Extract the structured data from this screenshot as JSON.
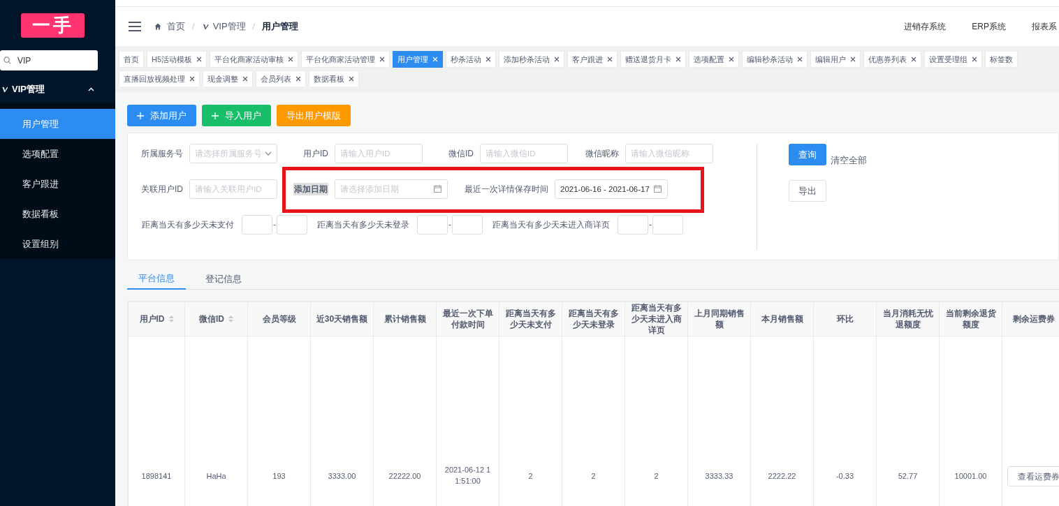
{
  "sidebar": {
    "logo": "一手",
    "search": {
      "value": "VIP"
    },
    "menu": {
      "label": "VIP管理",
      "expanded": true,
      "items": [
        {
          "label": "用户管理",
          "selected": true
        },
        {
          "label": "选项配置",
          "selected": false
        },
        {
          "label": "客户跟进",
          "selected": false
        },
        {
          "label": "数据看板",
          "selected": false
        },
        {
          "label": "设置组别",
          "selected": false
        }
      ]
    }
  },
  "header": {
    "breadcrumb": [
      "首页",
      "VIP管理",
      "用户管理"
    ],
    "separator": "/",
    "links": [
      "进销存系统",
      "ERP系统",
      "报表系"
    ]
  },
  "tab_rows": [
    [
      {
        "label": "首页",
        "closable": false,
        "selected": false
      },
      {
        "label": "H5活动模板",
        "closable": true,
        "selected": false
      },
      {
        "label": "平台化商家活动审核",
        "closable": true,
        "selected": false
      },
      {
        "label": "平台化商家活动管理",
        "closable": true,
        "selected": false
      },
      {
        "label": "用户管理",
        "closable": true,
        "selected": true
      },
      {
        "label": "秒杀活动",
        "closable": true,
        "selected": false
      },
      {
        "label": "添加秒杀活动",
        "closable": true,
        "selected": false
      },
      {
        "label": "客户跟进",
        "closable": true,
        "selected": false
      },
      {
        "label": "赠送退货月卡",
        "closable": true,
        "selected": false
      },
      {
        "label": "选项配置",
        "closable": true,
        "selected": false
      },
      {
        "label": "编辑秒杀活动",
        "closable": true,
        "selected": false
      },
      {
        "label": "编辑用户",
        "closable": true,
        "selected": false
      },
      {
        "label": "优惠券列表",
        "closable": true,
        "selected": false
      },
      {
        "label": "设置受理组",
        "closable": true,
        "selected": false
      },
      {
        "label": "标签数",
        "closable": false,
        "selected": false
      }
    ],
    [
      {
        "label": "直播回放视频处理",
        "closable": true,
        "selected": false
      },
      {
        "label": "现金调整",
        "closable": true,
        "selected": false
      },
      {
        "label": "会员列表",
        "closable": true,
        "selected": false
      },
      {
        "label": "数据看板",
        "closable": true,
        "selected": false
      }
    ]
  ],
  "actions": [
    {
      "label": "添加用户",
      "kind": "add",
      "color": "#2d8cf0"
    },
    {
      "label": "导入用户",
      "kind": "add",
      "color": "#19be6b"
    },
    {
      "label": "导出用户模版",
      "kind": "plain",
      "color": "#ff9900"
    }
  ],
  "filters": {
    "rows": [
      [
        {
          "label": "所属服务号",
          "kind": "select",
          "placeholder": "请选择所属服务号",
          "highlighted": false
        },
        {
          "label": "用户ID",
          "kind": "input",
          "placeholder": "请输入用户ID",
          "highlighted": false
        },
        {
          "label": "微信ID",
          "kind": "input",
          "placeholder": "请输入微信ID",
          "highlighted": false
        },
        {
          "label": "微信昵称",
          "kind": "input",
          "placeholder": "请输入微信昵称",
          "highlighted": false
        }
      ],
      [
        {
          "label": "关联用户ID",
          "kind": "input",
          "placeholder": "请输入关联用户ID",
          "highlighted": false
        },
        {
          "label": "添加日期",
          "kind": "date",
          "placeholder": "请选择添加日期",
          "highlighted": true
        },
        {
          "label": "最近一次详情保存时间",
          "kind": "date",
          "value": "2021-06-16 - 2021-06-17",
          "highlighted": false
        }
      ],
      [
        {
          "label": "距离当天有多少天未支付",
          "kind": "range",
          "separator": "-",
          "highlighted": false
        },
        {
          "label": "距离当天有多少天未登录",
          "kind": "range",
          "separator": "-",
          "highlighted": false
        },
        {
          "label": "距离当天有多少天未进入商详页",
          "kind": "range",
          "separator": "-",
          "highlighted": false
        }
      ]
    ],
    "buttons": [
      {
        "label": "查询",
        "kind": "primary"
      },
      {
        "label": "清空全部",
        "kind": "text"
      },
      {
        "label": "导出",
        "kind": "default"
      }
    ]
  },
  "info_tabs": [
    {
      "label": "平台信息",
      "selected": true
    },
    {
      "label": "登记信息",
      "selected": false
    }
  ],
  "table": {
    "columns": [
      {
        "label": "用户ID",
        "sortable": true
      },
      {
        "label": "微信ID",
        "sortable": true
      },
      {
        "label": "会员等级",
        "sortable": false
      },
      {
        "label": "近30天销售额",
        "sortable": false
      },
      {
        "label": "累计销售额",
        "sortable": false
      },
      {
        "label": "最近一次下单付款时间",
        "sortable": false
      },
      {
        "label": "距离当天有多少天未支付",
        "sortable": false
      },
      {
        "label": "距离当天有多少天未登录",
        "sortable": false
      },
      {
        "label": "距离当天有多少天未进入商详页",
        "sortable": false
      },
      {
        "label": "上月同期销售额",
        "sortable": false
      },
      {
        "label": "本月销售额",
        "sortable": false
      },
      {
        "label": "环比",
        "sortable": false
      },
      {
        "label": "当月消耗无忧退额度",
        "sortable": false
      },
      {
        "label": "当前剩余退货额度",
        "sortable": false
      },
      {
        "label": "剩余运费券",
        "sortable": false
      }
    ],
    "rows": [
      {
        "cells": [
          "1898141",
          "HaHa",
          "193",
          "3333.00",
          "22222.00",
          "2021-06-12 11:51:00",
          "2",
          "2",
          "2",
          "3333.33",
          "2222.22",
          "-0.33",
          "52.77",
          "10001.00"
        ],
        "action": "查看运费券"
      }
    ]
  }
}
